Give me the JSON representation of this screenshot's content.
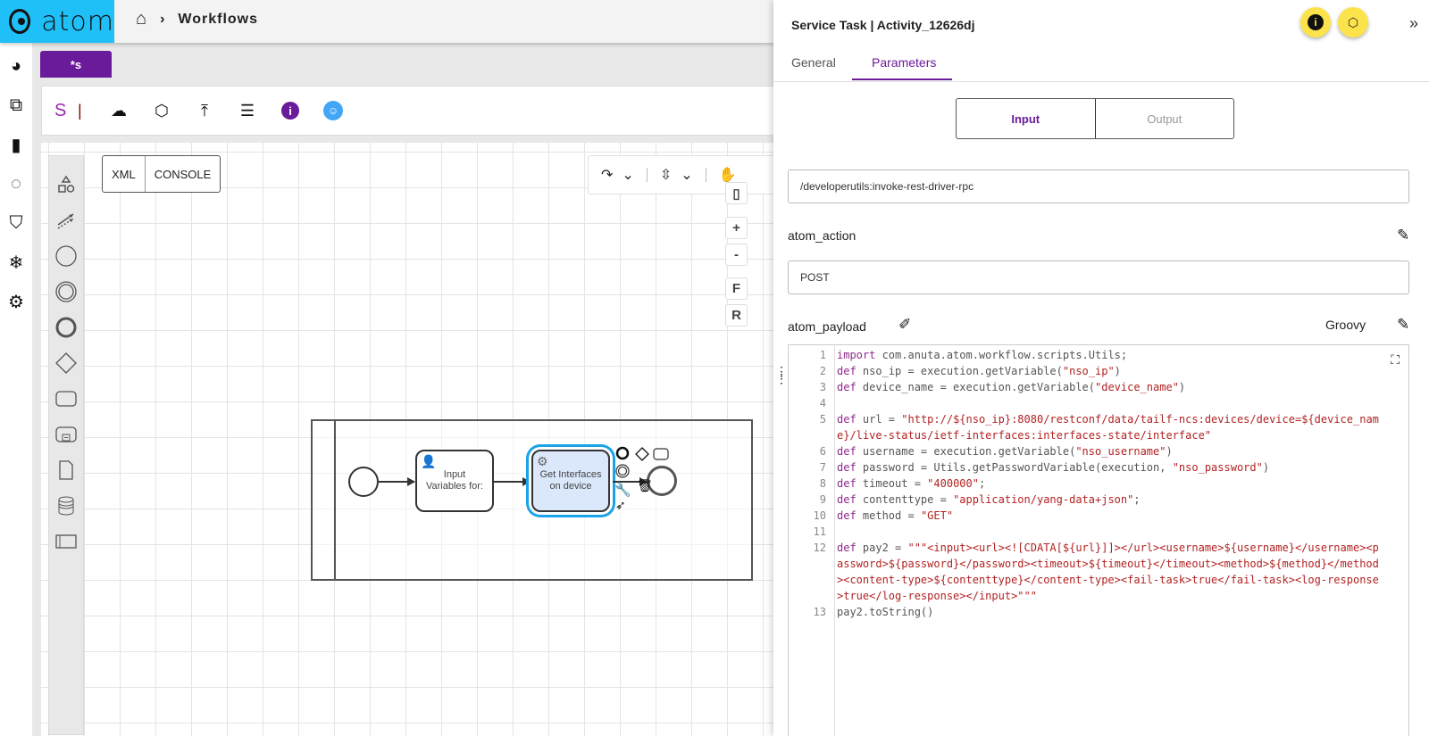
{
  "app": {
    "logo_text": "atom",
    "breadcrumb": {
      "current": "Workflows"
    }
  },
  "nav": {
    "items": [
      "dashboard",
      "devices",
      "analytics",
      "topology",
      "security",
      "snowflake",
      "settings"
    ]
  },
  "doc_tab": {
    "label": "*s"
  },
  "toolbar": {
    "s_label": "S",
    "separator": "|"
  },
  "canvas": {
    "xml_label": "XML",
    "console_label": "CONSOLE",
    "zoom_buttons": [
      "+",
      "-",
      "F",
      "R"
    ],
    "tasks": [
      {
        "label": "Input Variables for:",
        "type": "user-task"
      },
      {
        "label": "Get Interfaces on device",
        "type": "service-task",
        "selected": true
      }
    ]
  },
  "panel": {
    "title": "Service Task | Activity_12626dj",
    "tabs": [
      {
        "label": "General"
      },
      {
        "label": "Parameters",
        "active": true
      }
    ],
    "io_toggle": {
      "input": "Input",
      "output": "Output",
      "active": "Input"
    },
    "rpc_path": "/developerutils:invoke-rest-driver-rpc",
    "action_label": "atom_action",
    "action_value": "POST",
    "payload_label": "atom_payload",
    "payload_language": "Groovy",
    "code": [
      {
        "n": "1",
        "text": "import com.anuta.atom.workflow.scripts.Utils;"
      },
      {
        "n": "2",
        "text": "def nso_ip = execution.getVariable(\"nso_ip\")"
      },
      {
        "n": "3",
        "text": "def device_name = execution.getVariable(\"device_name\")"
      },
      {
        "n": "4",
        "text": ""
      },
      {
        "n": "5",
        "text": "def url = \"http://${nso_ip}:8080/restconf/data/tailf-ncs:devices/device=${device_name}/live-status/ietf-interfaces:interfaces-state/interface\""
      },
      {
        "n": "6",
        "text": "def username = execution.getVariable(\"nso_username\")"
      },
      {
        "n": "7",
        "text": "def password = Utils.getPasswordVariable(execution, \"nso_password\")"
      },
      {
        "n": "8",
        "text": "def timeout = \"400000\";"
      },
      {
        "n": "9",
        "text": "def contenttype = \"application/yang-data+json\";"
      },
      {
        "n": "10",
        "text": "def method = \"GET\""
      },
      {
        "n": "11",
        "text": ""
      },
      {
        "n": "12",
        "text": "def pay2 = \"\"\"<input><url><![CDATA[${url}]]></url><username>${username}</username><password>${password}</password><timeout>${timeout}</timeout><method>${method}</method><content-type>${contenttype}</content-type><fail-task>true</fail-task><log-response>true</log-response></input>\"\"\""
      },
      {
        "n": "13",
        "text": "pay2.toString()"
      }
    ]
  },
  "colors": {
    "brand": "#1fbff7",
    "accent": "#6a1b9a",
    "fab": "#fde34b",
    "selection": "#1aa3e8"
  }
}
